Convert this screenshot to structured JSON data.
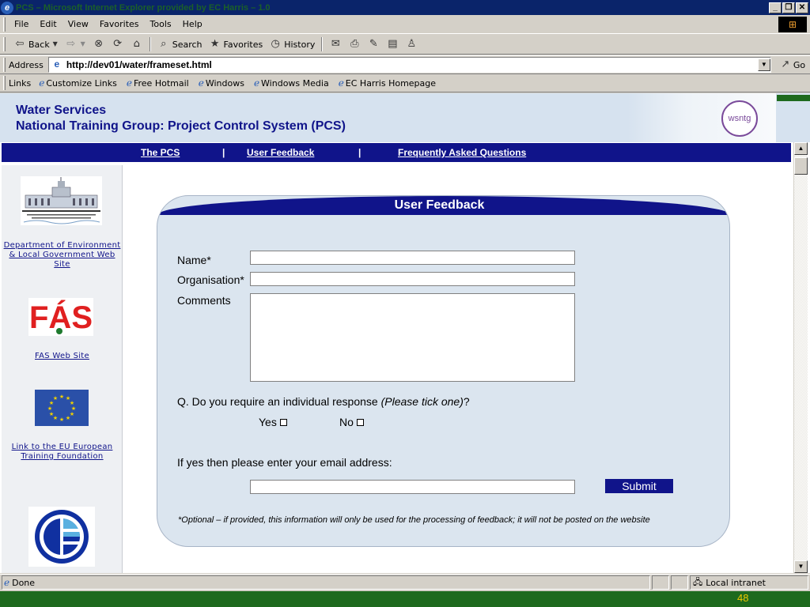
{
  "window": {
    "title": "PCS – Microsoft Internet Explorer provided by EC Harris – 1.0",
    "controls": [
      "_",
      "❐",
      "✕"
    ]
  },
  "menubar": {
    "items": [
      "File",
      "Edit",
      "View",
      "Favorites",
      "Tools",
      "Help"
    ]
  },
  "toolbar": {
    "back": "Back",
    "search": "Search",
    "favorites": "Favorites",
    "history": "History"
  },
  "address": {
    "label": "Address",
    "url": "http://dev01/water/frameset.html",
    "go": "Go"
  },
  "links": {
    "label": "Links",
    "items": [
      "Customize Links",
      "Free Hotmail",
      "Windows",
      "Windows Media",
      "EC Harris Homepage"
    ]
  },
  "banner": {
    "line1": "Water Services",
    "line2": "National Training Group: Project Control System (PCS)",
    "logo_text": "wsntg"
  },
  "nav": {
    "items": [
      "The PCS",
      "User Feedback",
      "Frequently Asked Questions"
    ],
    "separator": "|"
  },
  "sidebar": {
    "links": [
      "Department of Environment & Local Government Web Site",
      "FAS Web Site",
      "Link to the EU European Training Foundation"
    ],
    "fas_logo": "FÁS"
  },
  "form": {
    "heading": "User Feedback",
    "name_label": "Name*",
    "org_label": "Organisation*",
    "comments_label": "Comments",
    "question": "Q. Do you require an individual response ",
    "question_hint": "(Please tick one)",
    "question_end": "?",
    "yes": "Yes",
    "no": "No",
    "email_label": "If yes then please enter your email address:",
    "submit": "Submit",
    "note": "*Optional – if provided, this information will only be used for the processing of feedback; it will not be posted on the website"
  },
  "status": {
    "text": "Done",
    "zone": "Local intranet"
  },
  "slide": {
    "number": "48"
  },
  "colors": {
    "navy": "#10148a",
    "banner": "#d6e2ef",
    "panel": "#dbe5ef",
    "footer_green": "#1e6a1e",
    "slide_number": "#f0c800"
  }
}
